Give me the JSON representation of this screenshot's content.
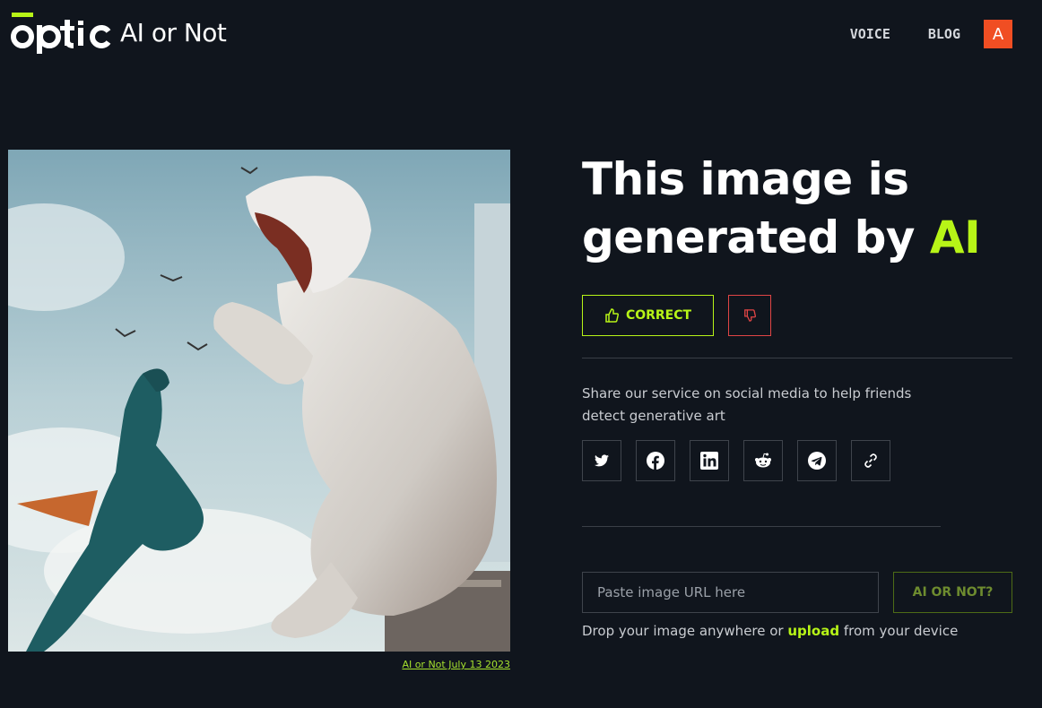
{
  "header": {
    "logo_text": "optic",
    "logo_subtitle": "AI or Not",
    "nav": [
      {
        "label": "VOICE"
      },
      {
        "label": "BLOG"
      }
    ],
    "avatar_initial": "A"
  },
  "preview": {
    "caption": "AI or Not July 13 2023"
  },
  "result": {
    "headline_line1": "This image is",
    "headline_line2_prefix": "generated by ",
    "headline_accent": "AI",
    "correct_label": "CORRECT",
    "colors": {
      "accent": "#b7f417",
      "wrong": "#e04545"
    }
  },
  "share": {
    "text": "Share our service on social media to help friends detect generative art",
    "icons": [
      "twitter-icon",
      "facebook-icon",
      "linkedin-icon",
      "reddit-icon",
      "telegram-icon",
      "link-icon"
    ]
  },
  "check": {
    "placeholder": "Paste image URL here",
    "button_label": "AI OR NOT?",
    "drop_prefix": "Drop your image anywhere or ",
    "drop_link": "upload",
    "drop_suffix": " from your device"
  }
}
